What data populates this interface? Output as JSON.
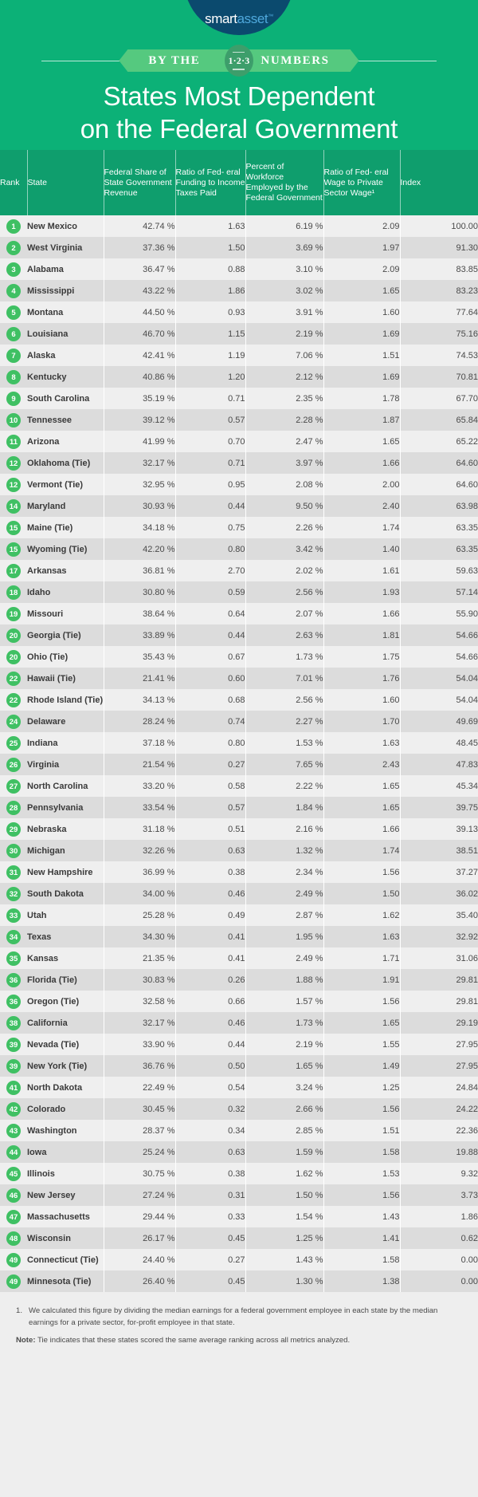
{
  "brand": {
    "logo_smart": "smart",
    "logo_asset": "asset",
    "logo_tm": "™"
  },
  "ribbon": {
    "left_label": "BY THE",
    "badge_digits": "1·2·3",
    "right_label": "NUMBERS"
  },
  "hero": {
    "title_line1": "States Most Dependent",
    "title_line2": "on the Federal Government"
  },
  "table": {
    "columns": [
      "Rank",
      "State",
      "Federal Share of State Government Revenue",
      "Ratio of Fed-eral Funding to Income Taxes Paid",
      "Percent of Workforce Employed by the Federal Government",
      "Ratio of Fed-eral Wage to Private Sector Wage¹",
      "Index"
    ],
    "columns_display": {
      "rank": "Rank",
      "state": "State",
      "share": "Federal Share of State Government Revenue",
      "ratio": "Ratio of Fed-\neral Funding to Income Taxes Paid",
      "percent": "Percent of Workforce Employed by the Federal Government",
      "wage": "Ratio of Fed-\neral Wage to Private Sector Wage¹",
      "index": "Index"
    },
    "rows": [
      {
        "rank": "1",
        "state": "New Mexico",
        "share": "42.74 %",
        "ratio": "1.63",
        "percent": "6.19 %",
        "wage": "2.09",
        "index": "100.00"
      },
      {
        "rank": "2",
        "state": "West Virginia",
        "share": "37.36 %",
        "ratio": "1.50",
        "percent": "3.69 %",
        "wage": "1.97",
        "index": "91.30"
      },
      {
        "rank": "3",
        "state": "Alabama",
        "share": "36.47 %",
        "ratio": "0.88",
        "percent": "3.10 %",
        "wage": "2.09",
        "index": "83.85"
      },
      {
        "rank": "4",
        "state": "Mississippi",
        "share": "43.22 %",
        "ratio": "1.86",
        "percent": "3.02 %",
        "wage": "1.65",
        "index": "83.23"
      },
      {
        "rank": "5",
        "state": "Montana",
        "share": "44.50 %",
        "ratio": "0.93",
        "percent": "3.91 %",
        "wage": "1.60",
        "index": "77.64"
      },
      {
        "rank": "6",
        "state": "Louisiana",
        "share": "46.70 %",
        "ratio": "1.15",
        "percent": "2.19 %",
        "wage": "1.69",
        "index": "75.16"
      },
      {
        "rank": "7",
        "state": "Alaska",
        "share": "42.41 %",
        "ratio": "1.19",
        "percent": "7.06 %",
        "wage": "1.51",
        "index": "74.53"
      },
      {
        "rank": "8",
        "state": "Kentucky",
        "share": "40.86 %",
        "ratio": "1.20",
        "percent": "2.12 %",
        "wage": "1.69",
        "index": "70.81"
      },
      {
        "rank": "9",
        "state": "South Carolina",
        "share": "35.19 %",
        "ratio": "0.71",
        "percent": "2.35 %",
        "wage": "1.78",
        "index": "67.70"
      },
      {
        "rank": "10",
        "state": "Tennessee",
        "share": "39.12 %",
        "ratio": "0.57",
        "percent": "2.28 %",
        "wage": "1.87",
        "index": "65.84"
      },
      {
        "rank": "11",
        "state": "Arizona",
        "share": "41.99 %",
        "ratio": "0.70",
        "percent": "2.47 %",
        "wage": "1.65",
        "index": "65.22"
      },
      {
        "rank": "12",
        "state": "Oklahoma (Tie)",
        "share": "32.17 %",
        "ratio": "0.71",
        "percent": "3.97 %",
        "wage": "1.66",
        "index": "64.60"
      },
      {
        "rank": "12",
        "state": "Vermont (Tie)",
        "share": "32.95 %",
        "ratio": "0.95",
        "percent": "2.08 %",
        "wage": "2.00",
        "index": "64.60"
      },
      {
        "rank": "14",
        "state": "Maryland",
        "share": "30.93 %",
        "ratio": "0.44",
        "percent": "9.50 %",
        "wage": "2.40",
        "index": "63.98"
      },
      {
        "rank": "15",
        "state": "Maine (Tie)",
        "share": "34.18 %",
        "ratio": "0.75",
        "percent": "2.26 %",
        "wage": "1.74",
        "index": "63.35"
      },
      {
        "rank": "15",
        "state": "Wyoming (Tie)",
        "share": "42.20 %",
        "ratio": "0.80",
        "percent": "3.42 %",
        "wage": "1.40",
        "index": "63.35"
      },
      {
        "rank": "17",
        "state": "Arkansas",
        "share": "36.81 %",
        "ratio": "2.70",
        "percent": "2.02 %",
        "wage": "1.61",
        "index": "59.63"
      },
      {
        "rank": "18",
        "state": "Idaho",
        "share": "30.80 %",
        "ratio": "0.59",
        "percent": "2.56 %",
        "wage": "1.93",
        "index": "57.14"
      },
      {
        "rank": "19",
        "state": "Missouri",
        "share": "38.64 %",
        "ratio": "0.64",
        "percent": "2.07 %",
        "wage": "1.66",
        "index": "55.90"
      },
      {
        "rank": "20",
        "state": "Georgia (Tie)",
        "share": "33.89 %",
        "ratio": "0.44",
        "percent": "2.63 %",
        "wage": "1.81",
        "index": "54.66"
      },
      {
        "rank": "20",
        "state": "Ohio (Tie)",
        "share": "35.43 %",
        "ratio": "0.67",
        "percent": "1.73 %",
        "wage": "1.75",
        "index": "54.66"
      },
      {
        "rank": "22",
        "state": "Hawaii (Tie)",
        "share": "21.41 %",
        "ratio": "0.60",
        "percent": "7.01 %",
        "wage": "1.76",
        "index": "54.04"
      },
      {
        "rank": "22",
        "state": "Rhode Island (Tie)",
        "share": "34.13 %",
        "ratio": "0.68",
        "percent": "2.56 %",
        "wage": "1.60",
        "index": "54.04"
      },
      {
        "rank": "24",
        "state": "Delaware",
        "share": "28.24 %",
        "ratio": "0.74",
        "percent": "2.27 %",
        "wage": "1.70",
        "index": "49.69"
      },
      {
        "rank": "25",
        "state": "Indiana",
        "share": "37.18 %",
        "ratio": "0.80",
        "percent": "1.53 %",
        "wage": "1.63",
        "index": "48.45"
      },
      {
        "rank": "26",
        "state": "Virginia",
        "share": "21.54 %",
        "ratio": "0.27",
        "percent": "7.65 %",
        "wage": "2.43",
        "index": "47.83"
      },
      {
        "rank": "27",
        "state": "North Carolina",
        "share": "33.20 %",
        "ratio": "0.58",
        "percent": "2.22 %",
        "wage": "1.65",
        "index": "45.34"
      },
      {
        "rank": "28",
        "state": "Pennsylvania",
        "share": "33.54 %",
        "ratio": "0.57",
        "percent": "1.84 %",
        "wage": "1.65",
        "index": "39.75"
      },
      {
        "rank": "29",
        "state": "Nebraska",
        "share": "31.18 %",
        "ratio": "0.51",
        "percent": "2.16 %",
        "wage": "1.66",
        "index": "39.13"
      },
      {
        "rank": "30",
        "state": "Michigan",
        "share": "32.26 %",
        "ratio": "0.63",
        "percent": "1.32 %",
        "wage": "1.74",
        "index": "38.51"
      },
      {
        "rank": "31",
        "state": "New Hampshire",
        "share": "36.99 %",
        "ratio": "0.38",
        "percent": "2.34 %",
        "wage": "1.56",
        "index": "37.27"
      },
      {
        "rank": "32",
        "state": "South Dakota",
        "share": "34.00 %",
        "ratio": "0.46",
        "percent": "2.49 %",
        "wage": "1.50",
        "index": "36.02"
      },
      {
        "rank": "33",
        "state": "Utah",
        "share": "25.28 %",
        "ratio": "0.49",
        "percent": "2.87 %",
        "wage": "1.62",
        "index": "35.40"
      },
      {
        "rank": "34",
        "state": "Texas",
        "share": "34.30 %",
        "ratio": "0.41",
        "percent": "1.95 %",
        "wage": "1.63",
        "index": "32.92"
      },
      {
        "rank": "35",
        "state": "Kansas",
        "share": "21.35 %",
        "ratio": "0.41",
        "percent": "2.49 %",
        "wage": "1.71",
        "index": "31.06"
      },
      {
        "rank": "36",
        "state": "Florida (Tie)",
        "share": "30.83 %",
        "ratio": "0.26",
        "percent": "1.88 %",
        "wage": "1.91",
        "index": "29.81"
      },
      {
        "rank": "36",
        "state": "Oregon (Tie)",
        "share": "32.58 %",
        "ratio": "0.66",
        "percent": "1.57 %",
        "wage": "1.56",
        "index": "29.81"
      },
      {
        "rank": "38",
        "state": "California",
        "share": "32.17 %",
        "ratio": "0.46",
        "percent": "1.73 %",
        "wage": "1.65",
        "index": "29.19"
      },
      {
        "rank": "39",
        "state": "Nevada (Tie)",
        "share": "33.90 %",
        "ratio": "0.44",
        "percent": "2.19 %",
        "wage": "1.55",
        "index": "27.95"
      },
      {
        "rank": "39",
        "state": "New York (Tie)",
        "share": "36.76 %",
        "ratio": "0.50",
        "percent": "1.65 %",
        "wage": "1.49",
        "index": "27.95"
      },
      {
        "rank": "41",
        "state": "North Dakota",
        "share": "22.49 %",
        "ratio": "0.54",
        "percent": "3.24 %",
        "wage": "1.25",
        "index": "24.84"
      },
      {
        "rank": "42",
        "state": "Colorado",
        "share": "30.45 %",
        "ratio": "0.32",
        "percent": "2.66 %",
        "wage": "1.56",
        "index": "24.22"
      },
      {
        "rank": "43",
        "state": "Washington",
        "share": "28.37 %",
        "ratio": "0.34",
        "percent": "2.85 %",
        "wage": "1.51",
        "index": "22.36"
      },
      {
        "rank": "44",
        "state": "Iowa",
        "share": "25.24 %",
        "ratio": "0.63",
        "percent": "1.59 %",
        "wage": "1.58",
        "index": "19.88"
      },
      {
        "rank": "45",
        "state": "Illinois",
        "share": "30.75 %",
        "ratio": "0.38",
        "percent": "1.62 %",
        "wage": "1.53",
        "index": "9.32"
      },
      {
        "rank": "46",
        "state": "New Jersey",
        "share": "27.24 %",
        "ratio": "0.31",
        "percent": "1.50 %",
        "wage": "1.56",
        "index": "3.73"
      },
      {
        "rank": "47",
        "state": "Massachusetts",
        "share": "29.44 %",
        "ratio": "0.33",
        "percent": "1.54 %",
        "wage": "1.43",
        "index": "1.86"
      },
      {
        "rank": "48",
        "state": "Wisconsin",
        "share": "26.17 %",
        "ratio": "0.45",
        "percent": "1.25 %",
        "wage": "1.41",
        "index": "0.62"
      },
      {
        "rank": "49",
        "state": "Connecticut (Tie)",
        "share": "24.40 %",
        "ratio": "0.27",
        "percent": "1.43 %",
        "wage": "1.58",
        "index": "0.00"
      },
      {
        "rank": "49",
        "state": "Minnesota (Tie)",
        "share": "26.40 %",
        "ratio": "0.45",
        "percent": "1.30 %",
        "wage": "1.38",
        "index": "0.00"
      }
    ]
  },
  "footnotes": {
    "item1_marker": "1.",
    "item1_text": "We calculated this figure by dividing the median earnings for a federal government employee in each state by the median earnings for a private sector, for-profit employee in that state.",
    "note_label": "Note:",
    "note_text": "Tie indicates that these states scored the same average ranking across all metrics analyzed."
  },
  "colors": {
    "hero_green": "#0cb177",
    "header_green": "#0f9e6d",
    "ribbon_green": "#55c97f",
    "badge_green": "#3fc063",
    "logo_navy": "#0b4a6e",
    "logo_blue": "#4fa8dc",
    "row_odd": "#efefef",
    "row_even": "#dcdcdc"
  }
}
